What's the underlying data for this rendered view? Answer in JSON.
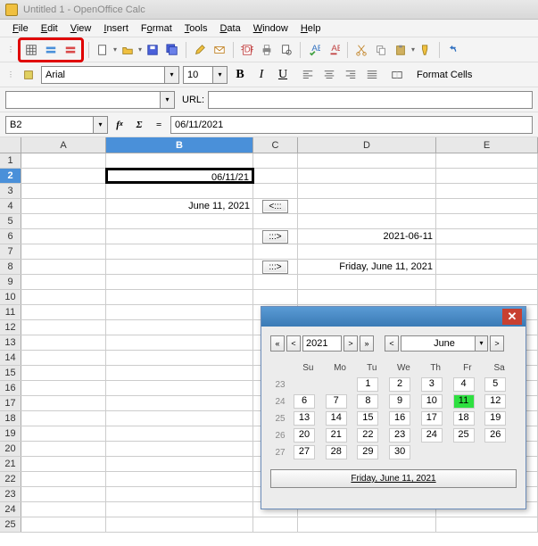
{
  "window": {
    "title": "Untitled 1 - OpenOffice Calc"
  },
  "menu": {
    "file": "File",
    "edit": "Edit",
    "view": "View",
    "insert": "Insert",
    "format": "Format",
    "tools": "Tools",
    "data": "Data",
    "window": "Window",
    "help": "Help"
  },
  "font": {
    "name": "Arial",
    "size": "10",
    "format_cells": "Format Cells"
  },
  "urlbar": {
    "label": "URL:"
  },
  "formula": {
    "cellref": "B2",
    "value": "06/11/2021"
  },
  "columns": [
    "A",
    "B",
    "C",
    "D",
    "E"
  ],
  "rows": [
    "1",
    "2",
    "3",
    "4",
    "5",
    "6",
    "7",
    "8",
    "9",
    "10",
    "11",
    "12",
    "13",
    "14",
    "15",
    "16",
    "17",
    "18",
    "19",
    "20",
    "21",
    "22",
    "23",
    "24",
    "25"
  ],
  "cells": {
    "b2": "06/11/21",
    "b4": "June 11, 2021",
    "c4": "<:::",
    "c6": ":::>",
    "d6": "2021-06-11",
    "c8": ":::>",
    "d8": "Friday, June 11, 2021"
  },
  "calendar": {
    "year": "2021",
    "month": "June",
    "prev2": "«",
    "prev": "<",
    "next": ">",
    "next2": "»",
    "daynames": [
      "Su",
      "Mo",
      "Tu",
      "We",
      "Th",
      "Fr",
      "Sa"
    ],
    "weeks": [
      {
        "wk": "23",
        "days": [
          "",
          "",
          "1",
          "2",
          "3",
          "4",
          "5"
        ]
      },
      {
        "wk": "24",
        "days": [
          "6",
          "7",
          "8",
          "9",
          "10",
          "11",
          "12"
        ]
      },
      {
        "wk": "25",
        "days": [
          "13",
          "14",
          "15",
          "16",
          "17",
          "18",
          "19"
        ]
      },
      {
        "wk": "26",
        "days": [
          "20",
          "21",
          "22",
          "23",
          "24",
          "25",
          "26"
        ]
      },
      {
        "wk": "27",
        "days": [
          "27",
          "28",
          "29",
          "30",
          "",
          "",
          ""
        ]
      }
    ],
    "selected_day": "11",
    "status": "Friday, June 11, 2021"
  }
}
